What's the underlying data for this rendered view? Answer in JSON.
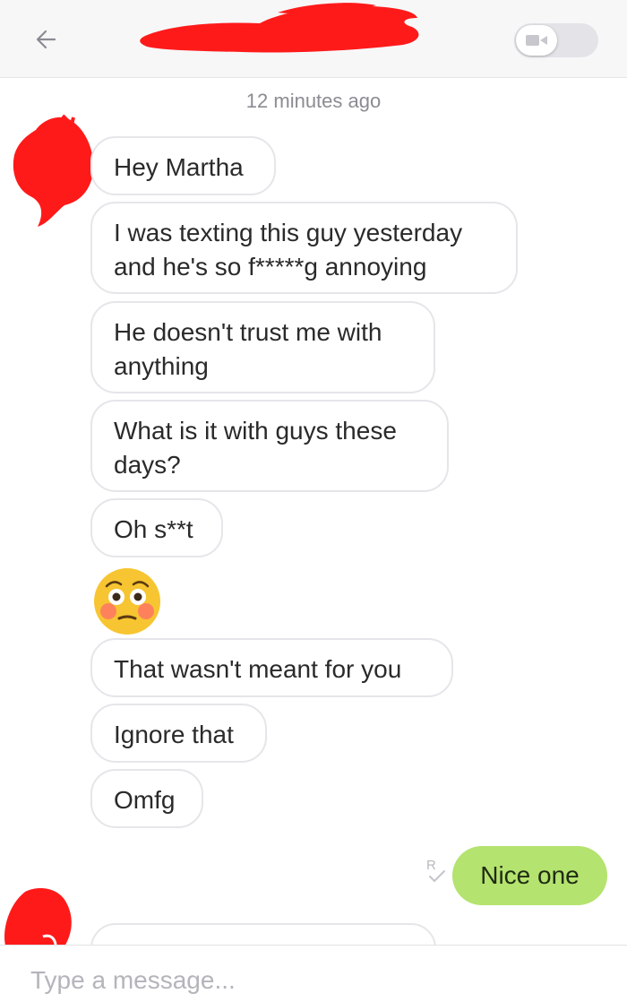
{
  "header": {
    "back_icon": "arrow-left-icon",
    "contact_name": "",
    "video_toggle_icon": "video-camera-icon"
  },
  "conversation": {
    "timestamp": "12 minutes ago",
    "incoming": [
      {
        "text": "Hey Martha"
      },
      {
        "text": "I was texting this guy yesterday\nand he's so f*****g annoying"
      },
      {
        "text": "He doesn't trust me with\nanything"
      },
      {
        "text": "What is it with guys these\ndays?"
      },
      {
        "text": "Oh s**t"
      },
      {
        "emoji": "flushed-face-emoji"
      },
      {
        "text": "That wasn't meant for you"
      },
      {
        "text": "Ignore that"
      },
      {
        "text": "Omfg"
      }
    ],
    "outgoing": [
      {
        "text": "Nice one",
        "receipt_icon": "read-receipt-icon"
      }
    ]
  },
  "composer": {
    "placeholder": "Type a message..."
  },
  "colors": {
    "outgoing_bubble": "#b4e36f",
    "incoming_border": "#e6e6ea",
    "header_bg": "#f7f7f8",
    "redaction": "#ff1a1a",
    "emoji_face": "#f7c531",
    "emoji_blush": "#ff6b6b"
  }
}
